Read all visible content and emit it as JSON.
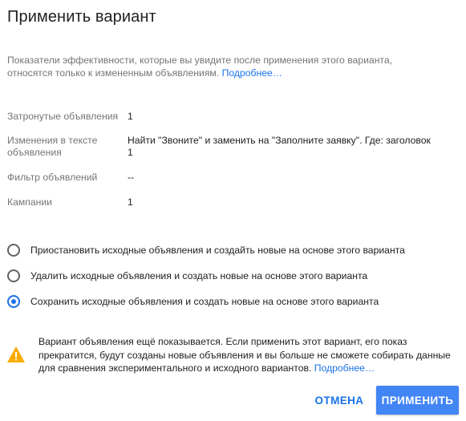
{
  "dialog": {
    "title": "Применить вариант",
    "description": "Показатели эффективности, которые вы увидите после применения этого варианта, относятся только к измененным объявлениям. ",
    "description_link": "Подробнее…"
  },
  "properties": [
    {
      "label": "Затронутые объявления",
      "value": "1"
    },
    {
      "label": "Изменения в тексте объявления",
      "value": "Найти \"Звоните\" и заменить на \"Заполните заявку\". Где: заголовок 1"
    },
    {
      "label": "Фильтр объявлений",
      "value": "--"
    },
    {
      "label": "Кампании",
      "value": "1"
    }
  ],
  "options": [
    {
      "label": "Приостановить исходные объявления и создайть новые на основе этого варианта",
      "checked": false
    },
    {
      "label": "Удалить исходные объявления и создать новые на основе этого варианта",
      "checked": false
    },
    {
      "label": "Сохранить исходные объявления и создать новые на основе этого варианта",
      "checked": true
    }
  ],
  "warning": {
    "icon": "warning-icon",
    "text": "Вариант объявления ещё показывается. Если применить этот вариант, его показ прекратится, будут созданы новые объявления и вы больше не сможете собирать данные для сравнения экспериментального и исходного вариантов. ",
    "link": "Подробнее…",
    "color": "#f9ab00"
  },
  "buttons": {
    "cancel": "ОТМЕНА",
    "apply": "ПРИМЕНИТЬ"
  },
  "colors": {
    "accent": "#1a73e8",
    "primary_button": "#4285f4"
  }
}
